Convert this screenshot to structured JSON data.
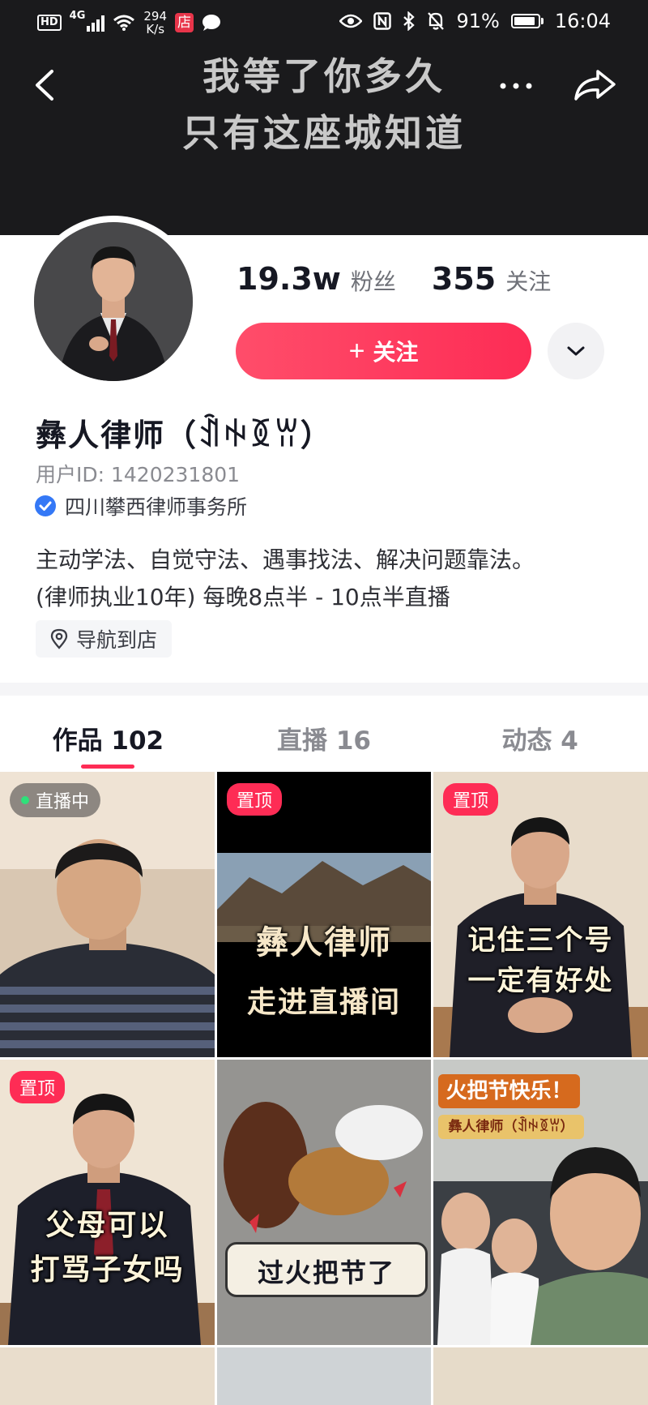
{
  "status_bar": {
    "hd": "HD",
    "network": "4G",
    "speed_value": "294",
    "speed_unit": "K/s",
    "shop_badge": "店",
    "battery": "91%",
    "battery_level": 0.91,
    "time": "16:04"
  },
  "banner": {
    "line1": "我等了你多久",
    "line2": "只有这座城知道"
  },
  "stats": {
    "followers_count": "19.3w",
    "followers_label": "粉丝",
    "following_count": "355",
    "following_label": "关注"
  },
  "follow_button": {
    "plus": "+",
    "label": "关注"
  },
  "profile": {
    "name": "彝人律师（ꀉꑭꅉꀕ）",
    "user_id": "用户ID: 1420231801",
    "verified_org": "四川攀西律师事务所",
    "bio_line1": "主动学法、自觉守法、遇事找法、解决问题靠法。",
    "bio_line2": "(律师执业10年) 每晚8点半 - 10点半直播",
    "nav_store": "导航到店"
  },
  "tabs": [
    {
      "label": "作品 102"
    },
    {
      "label": "直播 16"
    },
    {
      "label": "动态 4"
    }
  ],
  "videos": [
    {
      "badge": "直播中"
    },
    {
      "badge": "置顶",
      "text_top": "彝人律师",
      "text_bottom": "走进直播间"
    },
    {
      "badge": "置顶",
      "text_top": "记住三个号",
      "text_bottom": "一定有好处"
    },
    {
      "badge": "置顶",
      "text_top": "父母可以",
      "text_bottom": "打骂子女吗"
    },
    {
      "caption": "过火把节了"
    },
    {
      "title": "火把节快乐！",
      "subtitle": "彝人律师（ꀉꑭꅉꀕ）"
    }
  ],
  "colors": {
    "accent": "#fe2c55",
    "banner_bg": "#1a1a1c",
    "verified_blue": "#3478f6"
  },
  "icons": [
    "back-arrow-icon",
    "more-icon",
    "share-icon",
    "chevron-down-icon",
    "verified-icon",
    "location-pin-icon"
  ]
}
